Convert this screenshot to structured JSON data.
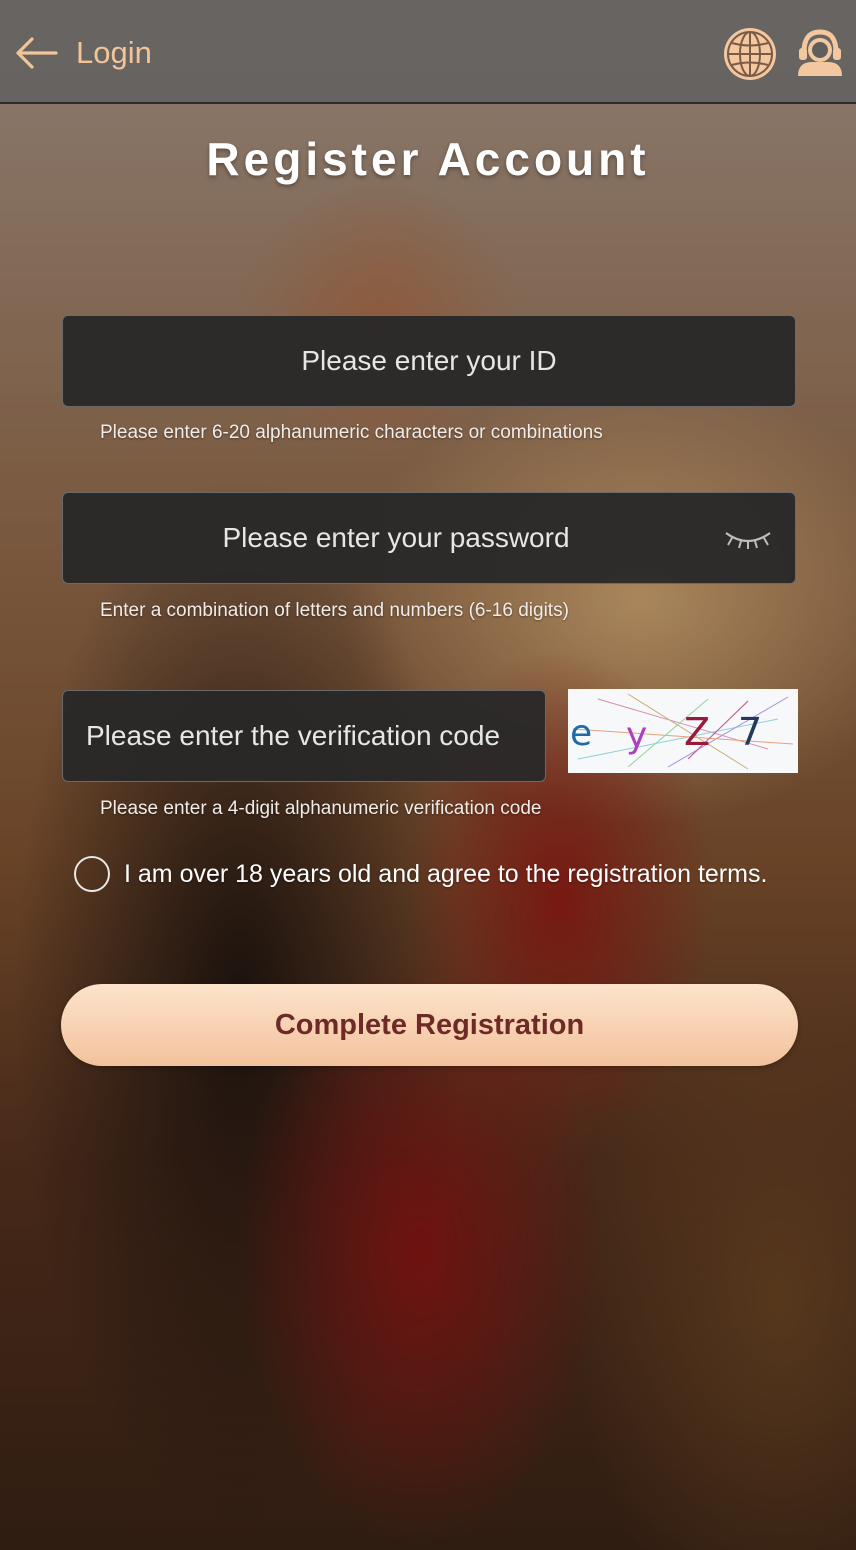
{
  "header": {
    "back_label": "Login",
    "icons": [
      "arrow-left-icon",
      "globe-icon",
      "customer-support-icon"
    ],
    "accent": "#f2c49a"
  },
  "form": {
    "title": "Register Account",
    "id_placeholder": "Please enter your ID",
    "id_hint": "Please enter 6-20 alphanumeric characters or combinations",
    "password_placeholder": "Please enter your password",
    "password_hint": "Enter a combination of letters and numbers (6-16 digits)",
    "code_placeholder": "Please enter the verification code",
    "code_hint": "Please enter a 4-digit alphanumeric verification code",
    "captcha_chars": [
      "e",
      "y",
      "Z",
      "7"
    ],
    "agree_label": "I am over 18 years old and agree to the registration terms.",
    "submit_label": "Complete Registration"
  },
  "colors": {
    "button_top": "#fde3cb",
    "button_bottom": "#f3c29c",
    "button_text": "#6e2a26",
    "field_bg": "#282828"
  }
}
